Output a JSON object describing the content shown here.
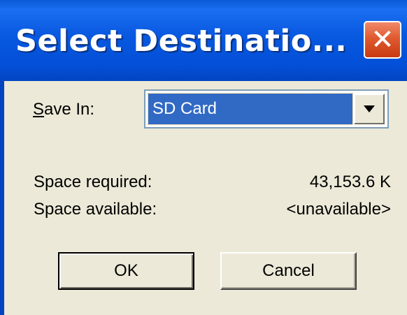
{
  "window": {
    "title": "Select Destinatio...",
    "close_glyph": "✕"
  },
  "form": {
    "save_in_label_underlined": "S",
    "save_in_label_rest": "ave In:",
    "save_in_value": "SD Card",
    "dropdown_icon": "chevron-down-icon"
  },
  "info": {
    "space_required_label": "Space required:",
    "space_required_value": "43,153.6 K",
    "space_available_label": "Space available:",
    "space_available_value": "<unavailable>"
  },
  "buttons": {
    "ok_label": "OK",
    "cancel_label": "Cancel"
  },
  "colors": {
    "titlebar": "#0450d8",
    "close_button": "#e05a30",
    "dialog_bg": "#ece9d8",
    "selection": "#316ac5"
  }
}
